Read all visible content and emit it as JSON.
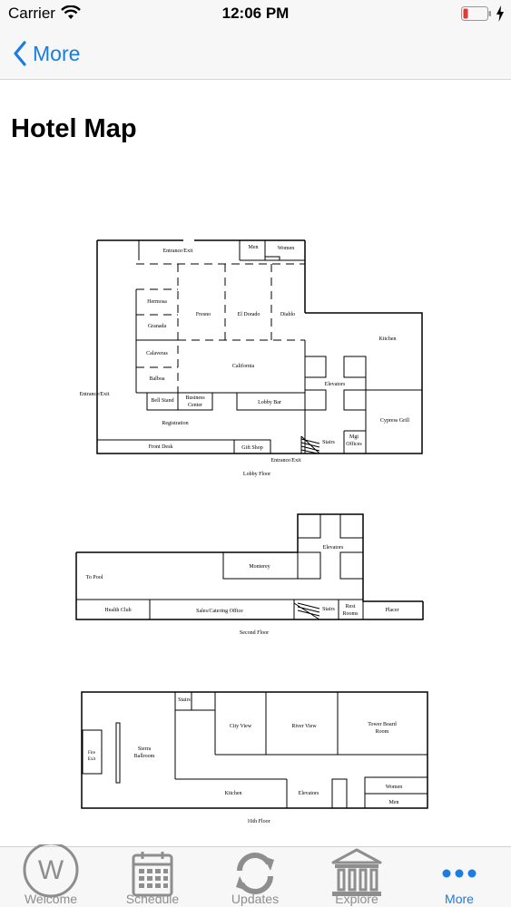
{
  "status_bar": {
    "carrier": "Carrier",
    "time": "12:06 PM"
  },
  "nav": {
    "back_label": "More"
  },
  "page": {
    "title": "Hotel Map"
  },
  "map": {
    "lobby": {
      "entrance_top": "Entrance/Exit",
      "men": "Men",
      "women": "Women",
      "hermosa": "Hermosa",
      "granada": "Granada",
      "calaveras": "Calaveras",
      "balboa": "Balboa",
      "fresno": "Fresno",
      "el_dorado": "El Dorado",
      "diablo": "Diablo",
      "california": "California",
      "kitchen": "Kitchen",
      "elevators": "Elevators",
      "entrance_left": "Entrance/Exit",
      "bell_stand": "Bell Stand",
      "business": "Business",
      "center": "Center",
      "lobby_bar": "Lobby Bar",
      "cypress_grill": "Cypress Grill",
      "registration": "Registration",
      "stairs": "Stairs",
      "mgt": "Mgt",
      "offices": "Offices",
      "front_desk": "Front Desk",
      "gift_shop": "Gift Shop",
      "entrance_bottom": "Entrance/Exit",
      "floor_label": "Lobby Floor"
    },
    "second": {
      "elevators": "Elevators",
      "monterey": "Monterey",
      "to_pool": "To Pool",
      "health_club": "Health Club",
      "sales_office": "Sales/Catering Office",
      "stairs": "Stairs",
      "rest": "Rest",
      "rooms": "Rooms",
      "placer": "Placer",
      "floor_label": "Second Floor"
    },
    "sixteenth": {
      "stairs": "Stairs",
      "city_view": "City View",
      "river_view": "River View",
      "tower_board": "Tower Board",
      "room": "Room",
      "sierra": "Sierra",
      "ballroom": "Ballroom",
      "fire": "Fire",
      "exit": "Exit",
      "kitchen": "Kitchen",
      "elevators": "Elevators",
      "women": "Women",
      "men": "Men",
      "floor_label": "16th Floor"
    }
  },
  "tabs": [
    {
      "label": "Welcome",
      "icon": "welcome-w-icon"
    },
    {
      "label": "Schedule",
      "icon": "calendar-icon"
    },
    {
      "label": "Updates",
      "icon": "refresh-icon"
    },
    {
      "label": "Explore",
      "icon": "building-icon"
    },
    {
      "label": "More",
      "icon": "more-dots-icon"
    }
  ],
  "colors": {
    "accent": "#1a7de0",
    "inactive": "#8e8e8e",
    "battery_low": "#e53935"
  }
}
